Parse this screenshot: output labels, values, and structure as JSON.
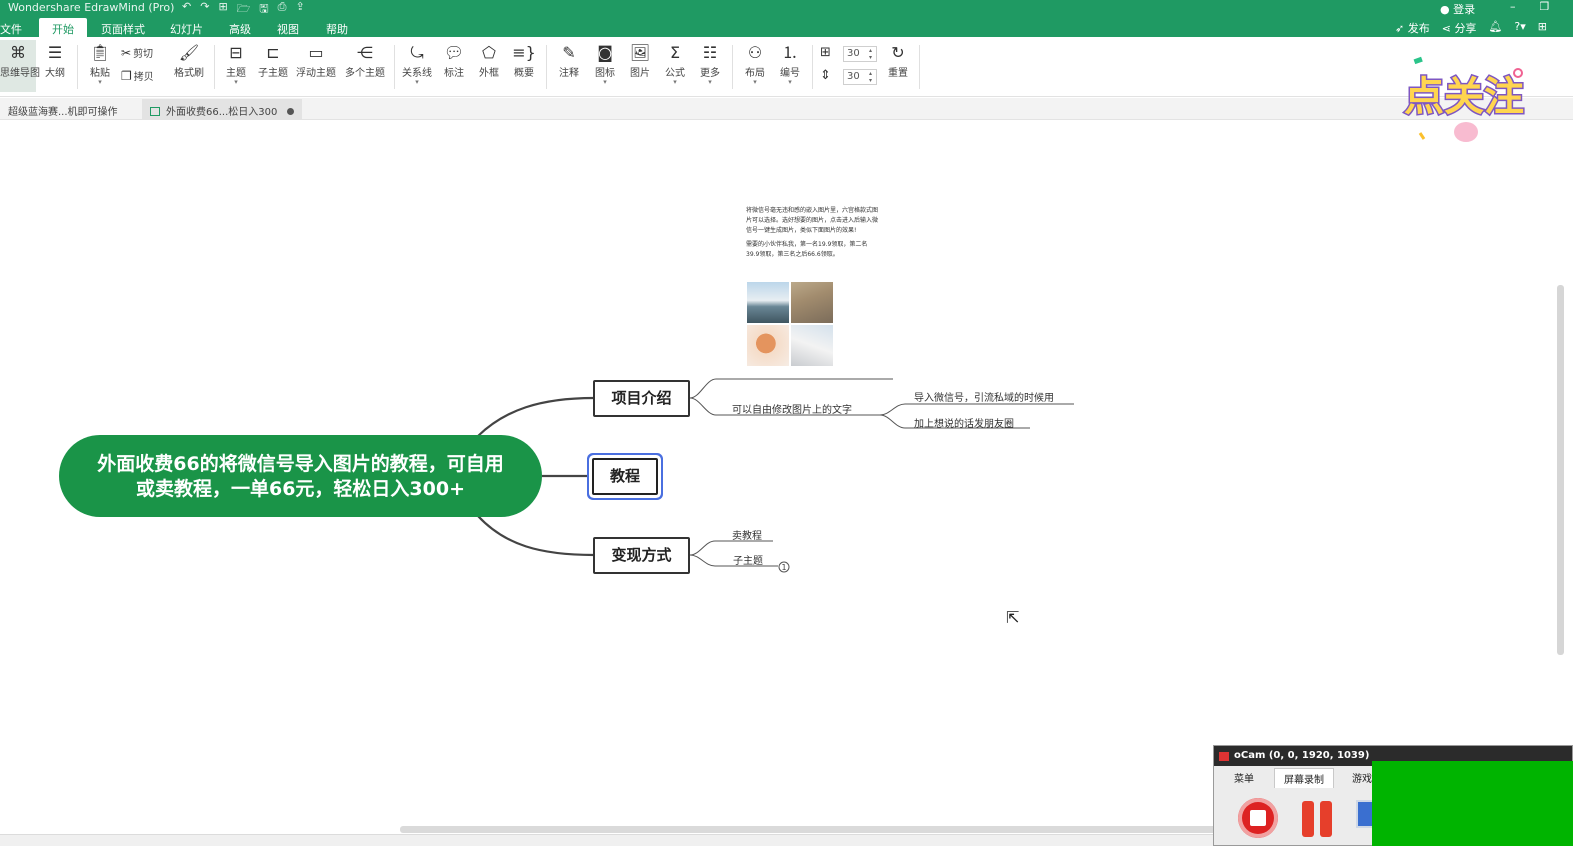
{
  "window": {
    "title": "Wondershare EdrawMind (Pro)",
    "login": "登录",
    "quick_access": [
      "↶",
      "↷",
      "⊞",
      "🗁",
      "🖫",
      "⎙",
      "⇪"
    ]
  },
  "menu": {
    "items": [
      "文件",
      "开始",
      "页面样式",
      "幻灯片",
      "高级",
      "视图",
      "帮助"
    ],
    "active": "开始",
    "publish": "发布",
    "share": "分享"
  },
  "ribbon": {
    "mindmap": "思维导图",
    "outline": "大纲",
    "paste": "粘贴",
    "cut": "剪切",
    "copy": "拷贝",
    "format_painter": "格式刷",
    "topic": "主题",
    "subtopic": "子主题",
    "floating_topic": "浮动主题",
    "multi_topic": "多个主题",
    "relationship": "关系线",
    "callout": "标注",
    "boundary": "外框",
    "summary": "概要",
    "note": "注释",
    "icon": "图标",
    "picture": "图片",
    "formula": "公式",
    "more": "更多",
    "layout": "布局",
    "numbering": "编号",
    "h_spacing": "30",
    "v_spacing": "30",
    "reset": "重置"
  },
  "tabs": [
    {
      "label": "超级蓝海赛...机即可操作",
      "active": false
    },
    {
      "label": "外面收费66...松日入300",
      "active": true
    }
  ],
  "mindmap": {
    "central": "外面收费66的将微信号导入图片的教程，可自用或卖教程，一单66元，轻松日入300+",
    "topics": {
      "intro": "项目介绍",
      "tutorial": "教程",
      "monetize": "变现方式"
    },
    "intro_sub": "可以自由修改图片上的文字",
    "intro_sub_children": [
      "导入微信号，引流私域的时候用",
      "加上想说的话发朋友圈"
    ],
    "monetize_children": [
      "卖教程",
      "子主题"
    ],
    "collapsed_count": "1",
    "note": {
      "para1": "将微信号毫无违和感的嵌入图片里，六宫格款式图片可以选择。选好想要的图片，点击进入后输入微信号一键生成图片，类似下面图片的效果!",
      "para2": "需要的小伙伴私我，第一名19.9领取，第二名39.9领取，第三名之后66.6领取。"
    }
  },
  "badge_text": "点关注",
  "ocam": {
    "title": "oCam (0, 0, 1920, 1039)",
    "tabs": [
      "菜单",
      "屏幕录制",
      "游戏"
    ]
  },
  "colors": {
    "brand": "#1f9a63",
    "central_fill": "#1a9448",
    "selection": "#4a6fe0"
  }
}
